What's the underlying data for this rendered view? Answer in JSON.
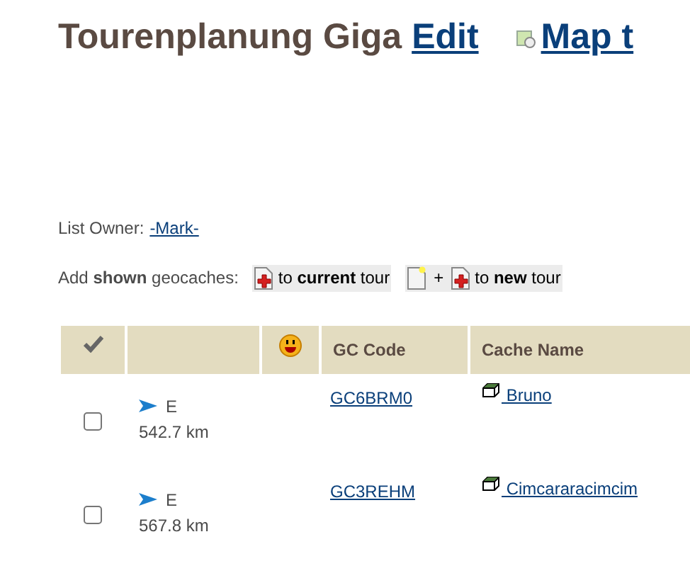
{
  "title": "Tourenplanung Giga",
  "edit_link": "Edit",
  "map_link": "Map t",
  "owner": {
    "label": "List Owner:",
    "name": "-Mark-"
  },
  "add": {
    "label": "Add **shown** geocaches:",
    "current_tour": "to **current** tour",
    "plus": "+",
    "new_tour": "to **new** tour"
  },
  "table": {
    "columns": [
      "GC Code",
      "Cache Name"
    ],
    "rows": [
      {
        "checked": false,
        "direction": "E",
        "distance": "542.7 km",
        "code": "GC6BRM0",
        "name": " Bruno"
      },
      {
        "checked": false,
        "direction": "E",
        "distance": "567.8 km",
        "code": "GC3REHM",
        "name": " Cimcararacimcim"
      }
    ]
  }
}
